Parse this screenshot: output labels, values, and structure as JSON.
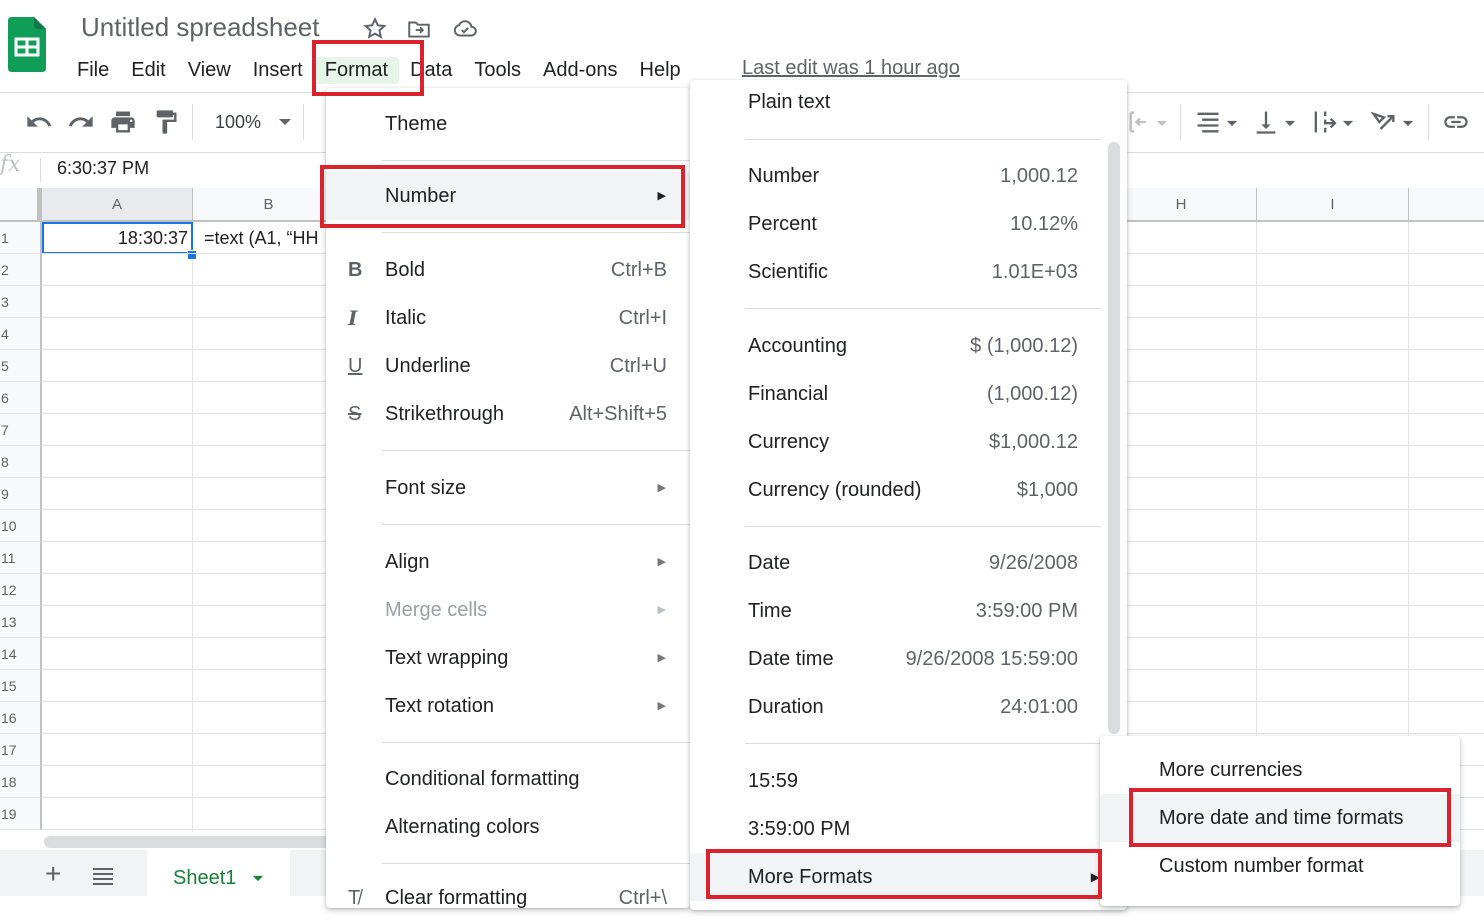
{
  "app": {
    "title": "Untitled spreadsheet",
    "last_edit": "Last edit was 1 hour ago",
    "brand_color": "#0f9d58",
    "highlight_color": "#d9232e"
  },
  "menubar": {
    "items": [
      {
        "label": "File"
      },
      {
        "label": "Edit"
      },
      {
        "label": "View"
      },
      {
        "label": "Insert"
      },
      {
        "label": "Format",
        "active": true
      },
      {
        "label": "Data"
      },
      {
        "label": "Tools"
      },
      {
        "label": "Add-ons"
      },
      {
        "label": "Help"
      }
    ]
  },
  "toolbar": {
    "zoom": "100%",
    "icons": [
      "undo-icon",
      "redo-icon",
      "print-icon",
      "paint-format-icon",
      "halign-icon",
      "valign-icon",
      "text-wrap-icon",
      "text-rotation-icon",
      "link-icon"
    ]
  },
  "formula_bar": {
    "fx": "fx",
    "value": "6:30:37 PM"
  },
  "grid": {
    "columns": [
      "A",
      "B",
      "H",
      "I"
    ],
    "rows": [
      "1",
      "2",
      "3",
      "4",
      "5",
      "6",
      "7",
      "8",
      "9",
      "10",
      "11",
      "12",
      "13",
      "14",
      "15",
      "16",
      "17",
      "18",
      "19"
    ],
    "cells": {
      "A1": "18:30:37",
      "B1": "=text (A1, “HH"
    }
  },
  "sheets": {
    "add_label": "+",
    "tabs": [
      {
        "label": "Sheet1"
      }
    ]
  },
  "format_menu": {
    "theme": "Theme",
    "number": "Number",
    "bold": {
      "label": "Bold",
      "shortcut": "Ctrl+B"
    },
    "italic": {
      "label": "Italic",
      "shortcut": "Ctrl+I"
    },
    "underline": {
      "label": "Underline",
      "shortcut": "Ctrl+U"
    },
    "strikethrough": {
      "label": "Strikethrough",
      "shortcut": "Alt+Shift+5"
    },
    "font_size": "Font size",
    "align": "Align",
    "merge_cells": "Merge cells",
    "text_wrapping": "Text wrapping",
    "text_rotation": "Text rotation",
    "conditional_formatting": "Conditional formatting",
    "alternating_colors": "Alternating colors",
    "clear_formatting": {
      "label": "Clear formatting",
      "shortcut": "Ctrl+\\"
    }
  },
  "number_menu": {
    "plain_text": "Plain text",
    "items": [
      {
        "label": "Number",
        "value": "1,000.12"
      },
      {
        "label": "Percent",
        "value": "10.12%"
      },
      {
        "label": "Scientific",
        "value": "1.01E+03"
      },
      {
        "label": "Accounting",
        "value": "$ (1,000.12)"
      },
      {
        "label": "Financial",
        "value": "(1,000.12)"
      },
      {
        "label": "Currency",
        "value": "$1,000.12"
      },
      {
        "label": "Currency (rounded)",
        "value": "$1,000"
      },
      {
        "label": "Date",
        "value": "9/26/2008"
      },
      {
        "label": "Time",
        "value": "3:59:00 PM"
      },
      {
        "label": "Date time",
        "value": "9/26/2008 15:59:00"
      },
      {
        "label": "Duration",
        "value": "24:01:00"
      }
    ],
    "recent": [
      "15:59",
      "3:59:00 PM"
    ],
    "more_formats": "More Formats"
  },
  "more_formats_menu": {
    "items": [
      {
        "label": "More currencies"
      },
      {
        "label": "More date and time formats",
        "highlighted": true
      },
      {
        "label": "Custom number format"
      }
    ]
  }
}
